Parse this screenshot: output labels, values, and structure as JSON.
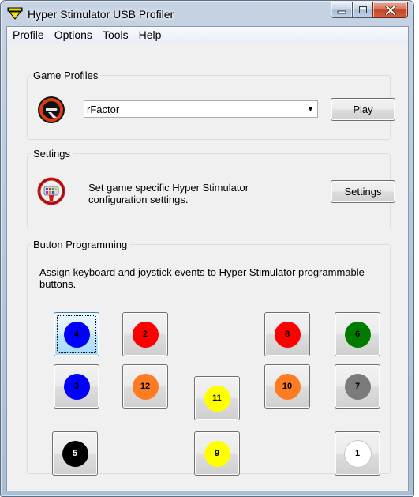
{
  "window": {
    "title": "Hyper Stimulator USB Profiler",
    "icon": "hyper-stimulator-app-icon"
  },
  "menu": [
    "Profile",
    "Options",
    "Tools",
    "Help"
  ],
  "game_profiles": {
    "legend": "Game Profiles",
    "selected_game": "rFactor",
    "play_label": "Play",
    "logo_icon": "rfactor-logo-icon"
  },
  "settings": {
    "legend": "Settings",
    "description": "Set game specific Hyper Stimulator configuration settings.",
    "button_label": "Settings",
    "icon": "steering-wheel-icon"
  },
  "button_programming": {
    "legend": "Button Programming",
    "description": "Assign keyboard and joystick events to  Hyper Stimulator programmable buttons.",
    "buttons": [
      {
        "number": "4",
        "color": "#0000ff",
        "focused": true
      },
      {
        "number": "2",
        "color": "#ff0000"
      },
      {
        "number": "8",
        "color": "#ff0000"
      },
      {
        "number": "6",
        "color": "#007b00"
      },
      {
        "number": "3",
        "color": "#0000ff"
      },
      {
        "number": "12",
        "color": "#ff7b21"
      },
      {
        "number": "11",
        "color": "#ffff00"
      },
      {
        "number": "10",
        "color": "#ff7b21"
      },
      {
        "number": "7",
        "color": "#7b7b7b"
      },
      {
        "number": "5",
        "color": "#000000"
      },
      {
        "number": "9",
        "color": "#ffff00"
      },
      {
        "number": "1",
        "color": "#ffffff"
      }
    ]
  }
}
